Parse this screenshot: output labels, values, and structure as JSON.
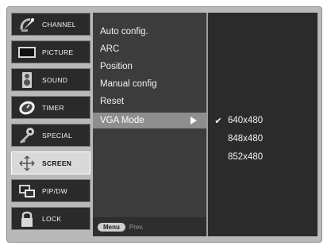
{
  "main_menu": [
    {
      "label": "CHANNEL",
      "icon": "satellite-dish-icon",
      "selected": false
    },
    {
      "label": "PICTURE",
      "icon": "tv-screen-icon",
      "selected": false
    },
    {
      "label": "SOUND",
      "icon": "speaker-icon",
      "selected": false
    },
    {
      "label": "TIMER",
      "icon": "clock-icon",
      "selected": false
    },
    {
      "label": "SPECIAL",
      "icon": "key-icon",
      "selected": false
    },
    {
      "label": "SCREEN",
      "icon": "screen-move-icon",
      "selected": true
    },
    {
      "label": "PIP/DW",
      "icon": "pip-windows-icon",
      "selected": false
    },
    {
      "label": "LOCK",
      "icon": "padlock-icon",
      "selected": false
    }
  ],
  "screen_menu": {
    "items": [
      {
        "label": "Auto config."
      },
      {
        "label": "ARC"
      },
      {
        "label": "Position"
      },
      {
        "label": "Manual config"
      },
      {
        "label": "Reset"
      },
      {
        "label": "VGA Mode",
        "highlighted": true
      }
    ],
    "footer": {
      "menu_button": "Menu",
      "prev_text": "Prev."
    }
  },
  "vga_mode_options": [
    {
      "label": "640x480",
      "checked": true
    },
    {
      "label": "848x480",
      "checked": false
    },
    {
      "label": "852x480",
      "checked": false
    }
  ],
  "colors": {
    "frame": "#b9b9b9",
    "menu_item_bg": "#2a2a2a",
    "submenu_bg": "#3c3c3c",
    "highlight": "#8e8e8e",
    "option_bg": "#2b2b2b"
  }
}
